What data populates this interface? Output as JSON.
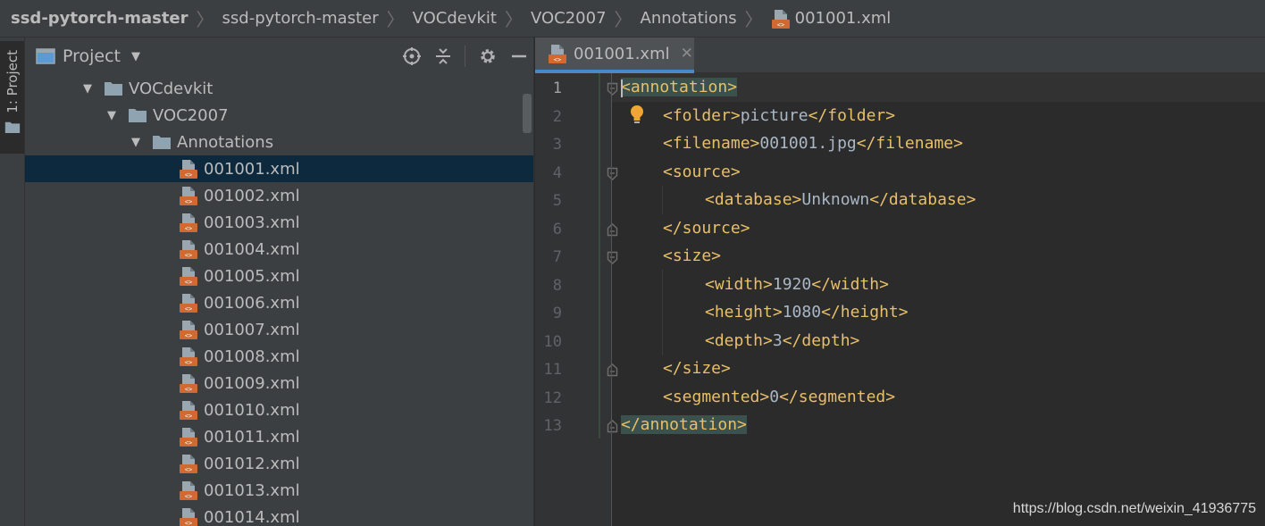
{
  "breadcrumb": {
    "items": [
      "ssd-pytorch-master",
      "ssd-pytorch-master",
      "VOCdevkit",
      "VOC2007",
      "Annotations"
    ],
    "file": "001001.xml"
  },
  "tool_stripe": {
    "label": "1: Project"
  },
  "project": {
    "title": "Project",
    "tree": {
      "voc_devkit": "VOCdevkit",
      "voc2007": "VOC2007",
      "annotations": "Annotations",
      "files": [
        "001001.xml",
        "001002.xml",
        "001003.xml",
        "001004.xml",
        "001005.xml",
        "001006.xml",
        "001007.xml",
        "001008.xml",
        "001009.xml",
        "001010.xml",
        "001011.xml",
        "001012.xml",
        "001013.xml",
        "001014.xml"
      ],
      "selected_file": "001001.xml"
    }
  },
  "editor": {
    "tab_label": "001001.xml",
    "current_line": "1",
    "line_numbers": [
      "1",
      "2",
      "3",
      "4",
      "5",
      "6",
      "7",
      "8",
      "9",
      "10",
      "11",
      "12",
      "13"
    ],
    "code": {
      "l1_tag": "<annotation>",
      "l2_open": "<folder>",
      "l2_text": "picture",
      "l2_close": "</folder>",
      "l3_open": "<filename>",
      "l3_text": "001001.jpg",
      "l3_close": "</filename>",
      "l4_tag": "<source>",
      "l5_open": "<database>",
      "l5_text": "Unknown",
      "l5_close": "</database>",
      "l6_tag": "</source>",
      "l7_tag": "<size>",
      "l8_open": "<width>",
      "l8_text": "1920",
      "l8_close": "</width>",
      "l9_open": "<height>",
      "l9_text": "1080",
      "l9_close": "</height>",
      "l10_open": "<depth>",
      "l10_text": "3",
      "l10_close": "</depth>",
      "l11_tag": "</size>",
      "l12_open": "<segmented>",
      "l12_text": "0",
      "l12_close": "</segmented>",
      "l13_tag": "</annotation>"
    }
  },
  "watermark": "https://blog.csdn.net/weixin_41936775",
  "icons": {
    "xml_file": "xml-file-icon",
    "folder": "folder-icon",
    "locate": "locate-icon",
    "collapse": "collapse-all-icon",
    "settings": "gear-icon",
    "hide": "minimize-icon",
    "bulb": "lightbulb-icon"
  },
  "colors": {
    "tag": "#e8bf6a",
    "text": "#a9b7c6",
    "selection": "#0d293e",
    "tab_underline": "#4a88c7"
  }
}
